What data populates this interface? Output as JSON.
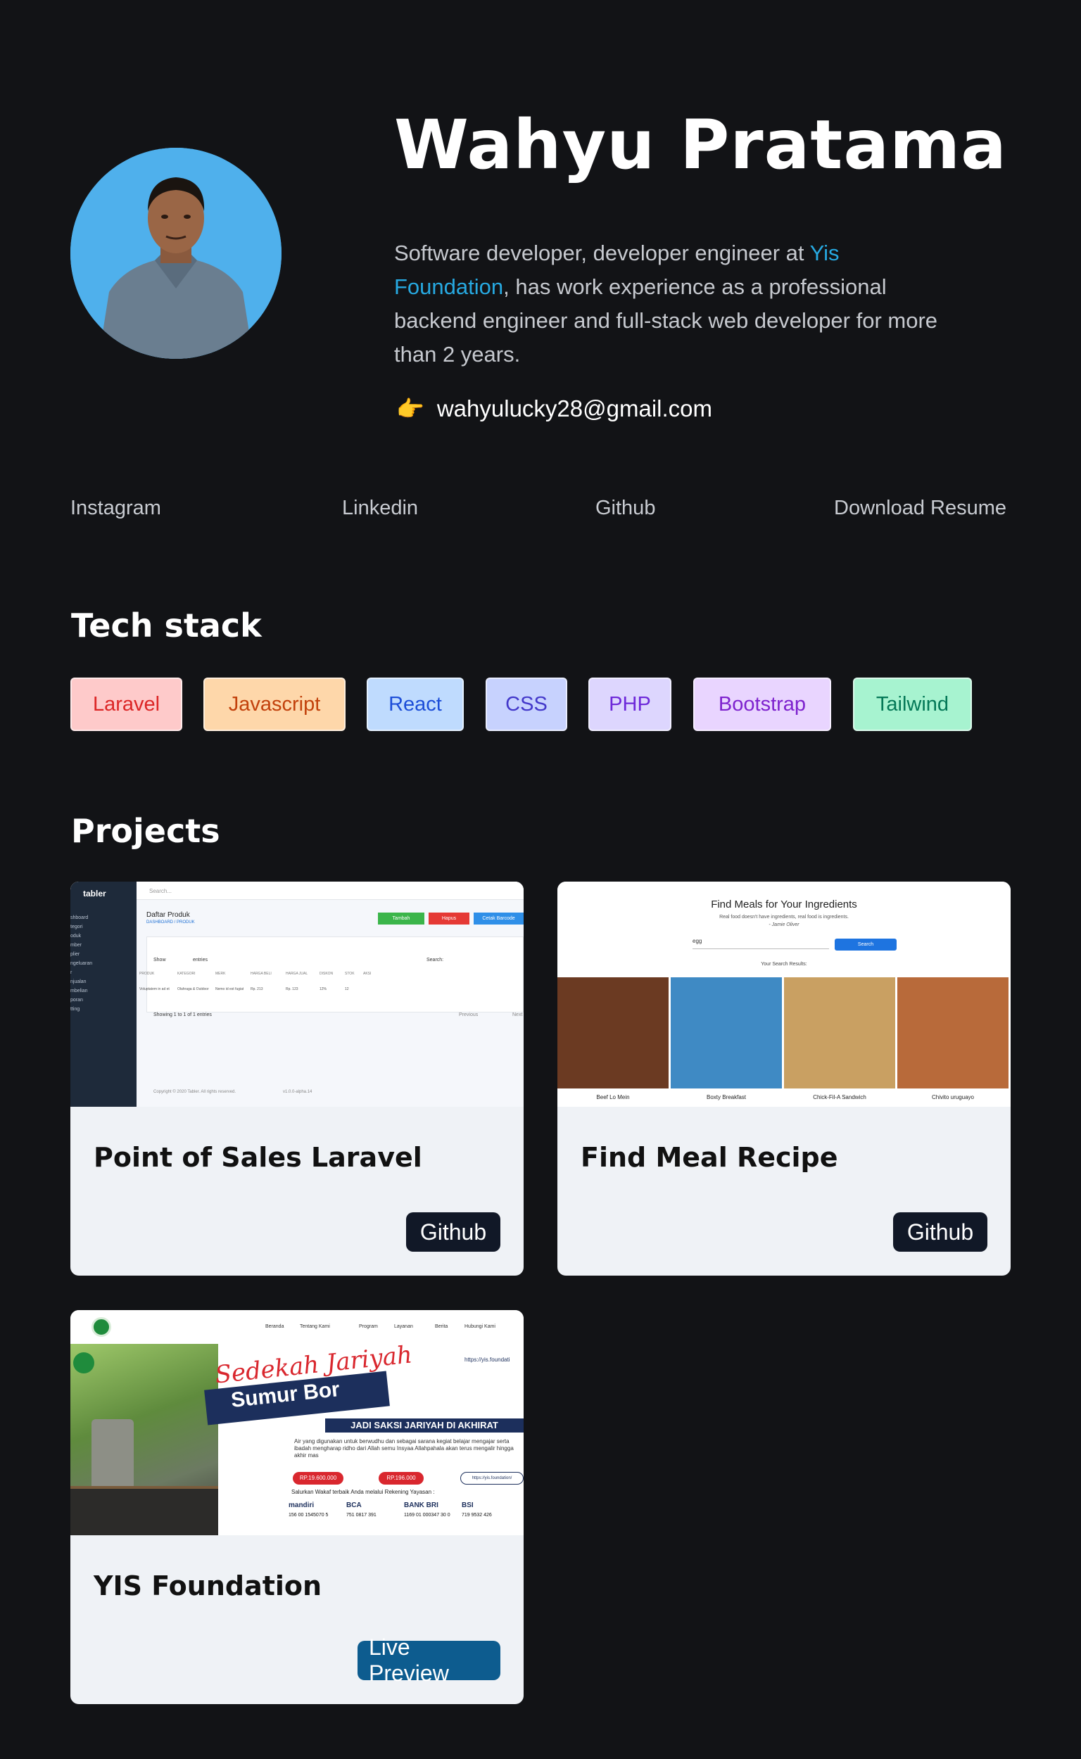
{
  "profile": {
    "name": "Wahyu Pratama",
    "bio_prefix": "Software developer, developer engineer at ",
    "bio_link": "Yis Foundation",
    "bio_suffix": ", has work experience as a professional backend engineer and full-stack web developer for more than 2 years.",
    "email_icon": "pointing-hand-icon",
    "email": "wahyulucky28@gmail.com"
  },
  "socials": [
    "Instagram",
    "Linkedin",
    "Github",
    "Download Resume"
  ],
  "tech_stack": {
    "title": "Tech stack",
    "items": [
      {
        "label": "Laravel",
        "bg": "#fecaca",
        "fg": "#dc2626"
      },
      {
        "label": "Javascript",
        "bg": "#fed7aa",
        "fg": "#c2410c"
      },
      {
        "label": "React",
        "bg": "#bfdbfe",
        "fg": "#1d4ed8"
      },
      {
        "label": "CSS",
        "bg": "#c7d2fe",
        "fg": "#4338ca"
      },
      {
        "label": "PHP",
        "bg": "#ddd6fe",
        "fg": "#6d28d9"
      },
      {
        "label": "Bootstrap",
        "bg": "#e9d5ff",
        "fg": "#7e22ce"
      },
      {
        "label": "Tailwind",
        "bg": "#a7f3d0",
        "fg": "#047857"
      }
    ]
  },
  "projects": {
    "title": "Projects",
    "items": [
      {
        "title": "Point of Sales Laravel",
        "button": "Github"
      },
      {
        "title": "Find Meal Recipe",
        "button": "Github"
      },
      {
        "title": "YIS Foundation",
        "button": "Live Preview"
      }
    ]
  },
  "shots": {
    "pos": {
      "brand": "tabler",
      "search": "Search...",
      "heading": "Daftar Produk",
      "crumb": "DASHBOARD / PRODUK",
      "btn_add": "Tambah",
      "btn_del": "Hapus",
      "btn_print": "Cetak Barcode",
      "show": "Show",
      "entries": "entries",
      "search_label": "Search:",
      "cols": [
        "PRODUK",
        "KATEGORI",
        "MERK",
        "HARGA BELI",
        "HARGA JUAL",
        "DISKON",
        "STOK",
        "AKSI"
      ],
      "row": [
        "Voluptatem in ad et",
        "Olahraga & Outdoor",
        "Nemo id est fugiat",
        "Rp. 213",
        "Rp. 123",
        "12%",
        "12"
      ],
      "showing": "Showing 1 to 1 of 1 entries",
      "prev": "Previous",
      "next": "Next",
      "copyright": "Copyright © 2020 Tabler. All rights reserved.",
      "version": "v1.0.0-alpha.14",
      "sidebar": [
        "shboard",
        "tegori",
        "oduk",
        "mber",
        "plier",
        "ngeluaran",
        "r",
        "njualan",
        "mbelian",
        "poran",
        "tting"
      ]
    },
    "meal": {
      "title": "Find Meals for Your Ingredients",
      "quote": "Real food doesn't have ingredients, real food is ingredients.",
      "author": "- Jamie Oliver",
      "input": "egg",
      "button": "Search",
      "results_label": "Your Search Results:",
      "results": [
        "Beef Lo Mein",
        "Boxty Breakfast",
        "Chick-Fil-A Sandwich",
        "Chivito uruguayo"
      ]
    },
    "yis": {
      "nav": [
        "Beranda",
        "Tentang Kami",
        "Program",
        "Layanan",
        "Berita",
        "Hubungi Kami"
      ],
      "headline1": "Sedekah Jariyah",
      "headline2": "Sumur Bor",
      "tagline": "JADI SAKSI JARIYAH DI AKHIRAT",
      "url": "https://yis.foundati",
      "body": "Air yang digunakan untuk berwudhu dan sebagai sarana kegiat belajar mengajar serta ibadah mengharap ridho dari Allah semu Insyaa Allahpahala akan terus mengalir hingga akhir mas",
      "price1": "RP.19.600.000",
      "price2": "RP.196.000",
      "donate_url": "https://yis.foundation/",
      "bank_line": "Salurkan Wakaf terbaik Anda melalui Rekening Yayasan :",
      "banks": [
        {
          "name": "mandiri",
          "number": "156 00 1545070 5"
        },
        {
          "name": "BCA",
          "number": "751 0817 391"
        },
        {
          "name": "BANK BRI",
          "number": "1169 01 000347 30 0"
        },
        {
          "name": "BSI",
          "number": "719 9532 426"
        }
      ]
    }
  }
}
